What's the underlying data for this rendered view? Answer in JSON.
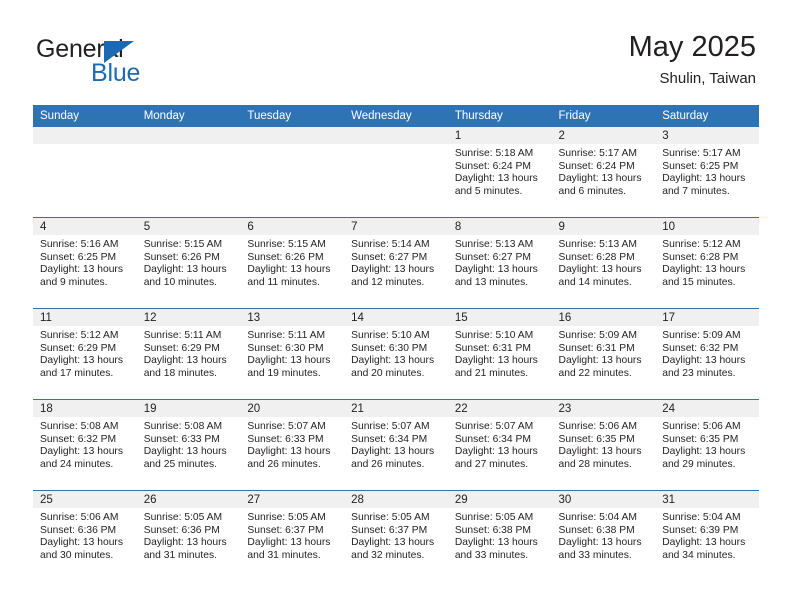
{
  "brand": {
    "name_part1": "General",
    "name_part2": "Blue",
    "accent_color": "#1b6ab3"
  },
  "header": {
    "title": "May 2025",
    "subtitle": "Shulin, Taiwan",
    "header_bg_color": "#2e74b5"
  },
  "calendar": {
    "weekday_headers": [
      "Sunday",
      "Monday",
      "Tuesday",
      "Wednesday",
      "Thursday",
      "Friday",
      "Saturday"
    ],
    "weeks": [
      [
        {
          "day": "",
          "sunrise": "",
          "sunset": "",
          "daylight_line1": "",
          "daylight_line2": ""
        },
        {
          "day": "",
          "sunrise": "",
          "sunset": "",
          "daylight_line1": "",
          "daylight_line2": ""
        },
        {
          "day": "",
          "sunrise": "",
          "sunset": "",
          "daylight_line1": "",
          "daylight_line2": ""
        },
        {
          "day": "",
          "sunrise": "",
          "sunset": "",
          "daylight_line1": "",
          "daylight_line2": ""
        },
        {
          "day": "1",
          "sunrise": "Sunrise: 5:18 AM",
          "sunset": "Sunset: 6:24 PM",
          "daylight_line1": "Daylight: 13 hours",
          "daylight_line2": "and 5 minutes."
        },
        {
          "day": "2",
          "sunrise": "Sunrise: 5:17 AM",
          "sunset": "Sunset: 6:24 PM",
          "daylight_line1": "Daylight: 13 hours",
          "daylight_line2": "and 6 minutes."
        },
        {
          "day": "3",
          "sunrise": "Sunrise: 5:17 AM",
          "sunset": "Sunset: 6:25 PM",
          "daylight_line1": "Daylight: 13 hours",
          "daylight_line2": "and 7 minutes."
        }
      ],
      [
        {
          "day": "4",
          "sunrise": "Sunrise: 5:16 AM",
          "sunset": "Sunset: 6:25 PM",
          "daylight_line1": "Daylight: 13 hours",
          "daylight_line2": "and 9 minutes."
        },
        {
          "day": "5",
          "sunrise": "Sunrise: 5:15 AM",
          "sunset": "Sunset: 6:26 PM",
          "daylight_line1": "Daylight: 13 hours",
          "daylight_line2": "and 10 minutes."
        },
        {
          "day": "6",
          "sunrise": "Sunrise: 5:15 AM",
          "sunset": "Sunset: 6:26 PM",
          "daylight_line1": "Daylight: 13 hours",
          "daylight_line2": "and 11 minutes."
        },
        {
          "day": "7",
          "sunrise": "Sunrise: 5:14 AM",
          "sunset": "Sunset: 6:27 PM",
          "daylight_line1": "Daylight: 13 hours",
          "daylight_line2": "and 12 minutes."
        },
        {
          "day": "8",
          "sunrise": "Sunrise: 5:13 AM",
          "sunset": "Sunset: 6:27 PM",
          "daylight_line1": "Daylight: 13 hours",
          "daylight_line2": "and 13 minutes."
        },
        {
          "day": "9",
          "sunrise": "Sunrise: 5:13 AM",
          "sunset": "Sunset: 6:28 PM",
          "daylight_line1": "Daylight: 13 hours",
          "daylight_line2": "and 14 minutes."
        },
        {
          "day": "10",
          "sunrise": "Sunrise: 5:12 AM",
          "sunset": "Sunset: 6:28 PM",
          "daylight_line1": "Daylight: 13 hours",
          "daylight_line2": "and 15 minutes."
        }
      ],
      [
        {
          "day": "11",
          "sunrise": "Sunrise: 5:12 AM",
          "sunset": "Sunset: 6:29 PM",
          "daylight_line1": "Daylight: 13 hours",
          "daylight_line2": "and 17 minutes."
        },
        {
          "day": "12",
          "sunrise": "Sunrise: 5:11 AM",
          "sunset": "Sunset: 6:29 PM",
          "daylight_line1": "Daylight: 13 hours",
          "daylight_line2": "and 18 minutes."
        },
        {
          "day": "13",
          "sunrise": "Sunrise: 5:11 AM",
          "sunset": "Sunset: 6:30 PM",
          "daylight_line1": "Daylight: 13 hours",
          "daylight_line2": "and 19 minutes."
        },
        {
          "day": "14",
          "sunrise": "Sunrise: 5:10 AM",
          "sunset": "Sunset: 6:30 PM",
          "daylight_line1": "Daylight: 13 hours",
          "daylight_line2": "and 20 minutes."
        },
        {
          "day": "15",
          "sunrise": "Sunrise: 5:10 AM",
          "sunset": "Sunset: 6:31 PM",
          "daylight_line1": "Daylight: 13 hours",
          "daylight_line2": "and 21 minutes."
        },
        {
          "day": "16",
          "sunrise": "Sunrise: 5:09 AM",
          "sunset": "Sunset: 6:31 PM",
          "daylight_line1": "Daylight: 13 hours",
          "daylight_line2": "and 22 minutes."
        },
        {
          "day": "17",
          "sunrise": "Sunrise: 5:09 AM",
          "sunset": "Sunset: 6:32 PM",
          "daylight_line1": "Daylight: 13 hours",
          "daylight_line2": "and 23 minutes."
        }
      ],
      [
        {
          "day": "18",
          "sunrise": "Sunrise: 5:08 AM",
          "sunset": "Sunset: 6:32 PM",
          "daylight_line1": "Daylight: 13 hours",
          "daylight_line2": "and 24 minutes."
        },
        {
          "day": "19",
          "sunrise": "Sunrise: 5:08 AM",
          "sunset": "Sunset: 6:33 PM",
          "daylight_line1": "Daylight: 13 hours",
          "daylight_line2": "and 25 minutes."
        },
        {
          "day": "20",
          "sunrise": "Sunrise: 5:07 AM",
          "sunset": "Sunset: 6:33 PM",
          "daylight_line1": "Daylight: 13 hours",
          "daylight_line2": "and 26 minutes."
        },
        {
          "day": "21",
          "sunrise": "Sunrise: 5:07 AM",
          "sunset": "Sunset: 6:34 PM",
          "daylight_line1": "Daylight: 13 hours",
          "daylight_line2": "and 26 minutes."
        },
        {
          "day": "22",
          "sunrise": "Sunrise: 5:07 AM",
          "sunset": "Sunset: 6:34 PM",
          "daylight_line1": "Daylight: 13 hours",
          "daylight_line2": "and 27 minutes."
        },
        {
          "day": "23",
          "sunrise": "Sunrise: 5:06 AM",
          "sunset": "Sunset: 6:35 PM",
          "daylight_line1": "Daylight: 13 hours",
          "daylight_line2": "and 28 minutes."
        },
        {
          "day": "24",
          "sunrise": "Sunrise: 5:06 AM",
          "sunset": "Sunset: 6:35 PM",
          "daylight_line1": "Daylight: 13 hours",
          "daylight_line2": "and 29 minutes."
        }
      ],
      [
        {
          "day": "25",
          "sunrise": "Sunrise: 5:06 AM",
          "sunset": "Sunset: 6:36 PM",
          "daylight_line1": "Daylight: 13 hours",
          "daylight_line2": "and 30 minutes."
        },
        {
          "day": "26",
          "sunrise": "Sunrise: 5:05 AM",
          "sunset": "Sunset: 6:36 PM",
          "daylight_line1": "Daylight: 13 hours",
          "daylight_line2": "and 31 minutes."
        },
        {
          "day": "27",
          "sunrise": "Sunrise: 5:05 AM",
          "sunset": "Sunset: 6:37 PM",
          "daylight_line1": "Daylight: 13 hours",
          "daylight_line2": "and 31 minutes."
        },
        {
          "day": "28",
          "sunrise": "Sunrise: 5:05 AM",
          "sunset": "Sunset: 6:37 PM",
          "daylight_line1": "Daylight: 13 hours",
          "daylight_line2": "and 32 minutes."
        },
        {
          "day": "29",
          "sunrise": "Sunrise: 5:05 AM",
          "sunset": "Sunset: 6:38 PM",
          "daylight_line1": "Daylight: 13 hours",
          "daylight_line2": "and 33 minutes."
        },
        {
          "day": "30",
          "sunrise": "Sunrise: 5:04 AM",
          "sunset": "Sunset: 6:38 PM",
          "daylight_line1": "Daylight: 13 hours",
          "daylight_line2": "and 33 minutes."
        },
        {
          "day": "31",
          "sunrise": "Sunrise: 5:04 AM",
          "sunset": "Sunset: 6:39 PM",
          "daylight_line1": "Daylight: 13 hours",
          "daylight_line2": "and 34 minutes."
        }
      ]
    ]
  }
}
